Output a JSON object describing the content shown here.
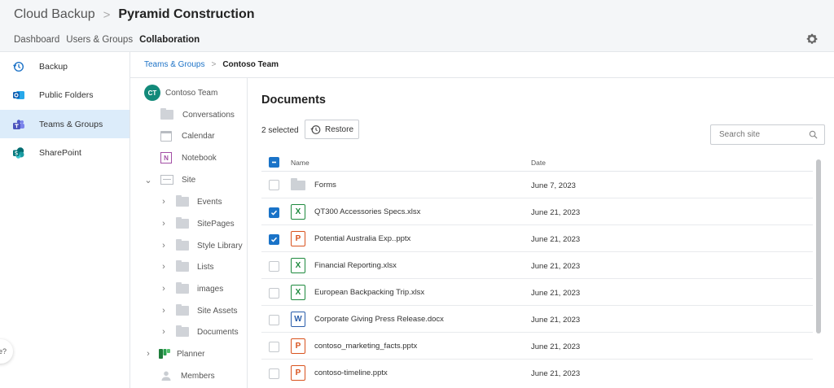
{
  "header": {
    "app_name": "Cloud Backup",
    "separator": ">",
    "org_name": "Pyramid Construction",
    "nav": [
      {
        "label": "Dashboard"
      },
      {
        "label": "Users & Groups"
      },
      {
        "label": "Collaboration",
        "active": true
      }
    ],
    "settings_icon": "gear-icon"
  },
  "sidebar": {
    "items": [
      {
        "label": "Backup",
        "icon": "backup-history-icon"
      },
      {
        "label": "Public Folders",
        "icon": "outlook-icon"
      },
      {
        "label": "Teams & Groups",
        "icon": "teams-icon",
        "active": true
      },
      {
        "label": "SharePoint",
        "icon": "sharepoint-icon"
      }
    ],
    "help_text": "e?"
  },
  "breadcrumb": {
    "link": "Teams & Groups",
    "separator": ">",
    "current": "Contoso Team"
  },
  "tree": {
    "team": {
      "badge": "CT",
      "label": "Contoso Team"
    },
    "items": [
      {
        "label": "Conversations"
      },
      {
        "label": "Calendar"
      },
      {
        "label": "Notebook",
        "badge": "N"
      },
      {
        "label": "Site"
      },
      {
        "label": "Events"
      },
      {
        "label": "SitePages"
      },
      {
        "label": "Style Library"
      },
      {
        "label": "Lists"
      },
      {
        "label": "images"
      },
      {
        "label": "Site Assets"
      },
      {
        "label": "Documents"
      },
      {
        "label": "Planner"
      },
      {
        "label": "Members"
      }
    ]
  },
  "main": {
    "title": "Documents",
    "selected_text": "2 selected",
    "restore_label": "Restore",
    "search_placeholder": "Search site",
    "columns": {
      "name": "Name",
      "date": "Date"
    },
    "rows": [
      {
        "type": "folder",
        "badge": "",
        "name": "Forms",
        "date": "June 7, 2023",
        "checked": false
      },
      {
        "type": "x",
        "badge": "X",
        "name": "QT300 Accessories Specs.xlsx",
        "date": "June 21, 2023",
        "checked": true
      },
      {
        "type": "p",
        "badge": "P",
        "name": "Potential Australia Exp..pptx",
        "date": "June 21, 2023",
        "checked": true
      },
      {
        "type": "x",
        "badge": "X",
        "name": "Financial Reporting.xlsx",
        "date": "June 21, 2023",
        "checked": false
      },
      {
        "type": "x",
        "badge": "X",
        "name": "European Backpacking Trip.xlsx",
        "date": "June 21, 2023",
        "checked": false
      },
      {
        "type": "w",
        "badge": "W",
        "name": "Corporate Giving Press Release.docx",
        "date": "June 21, 2023",
        "checked": false
      },
      {
        "type": "p",
        "badge": "P",
        "name": "contoso_marketing_facts.pptx",
        "date": "June 21, 2023",
        "checked": false
      },
      {
        "type": "p",
        "badge": "P",
        "name": "contoso-timeline.pptx",
        "date": "June 21, 2023",
        "checked": false
      }
    ]
  },
  "colors": {
    "accent": "#1a73c8",
    "active_bg": "#dcecfa",
    "excel": "#1e8a3e",
    "powerpoint": "#d9531e",
    "word": "#2b5eab",
    "teams_badge": "#138a7a"
  }
}
